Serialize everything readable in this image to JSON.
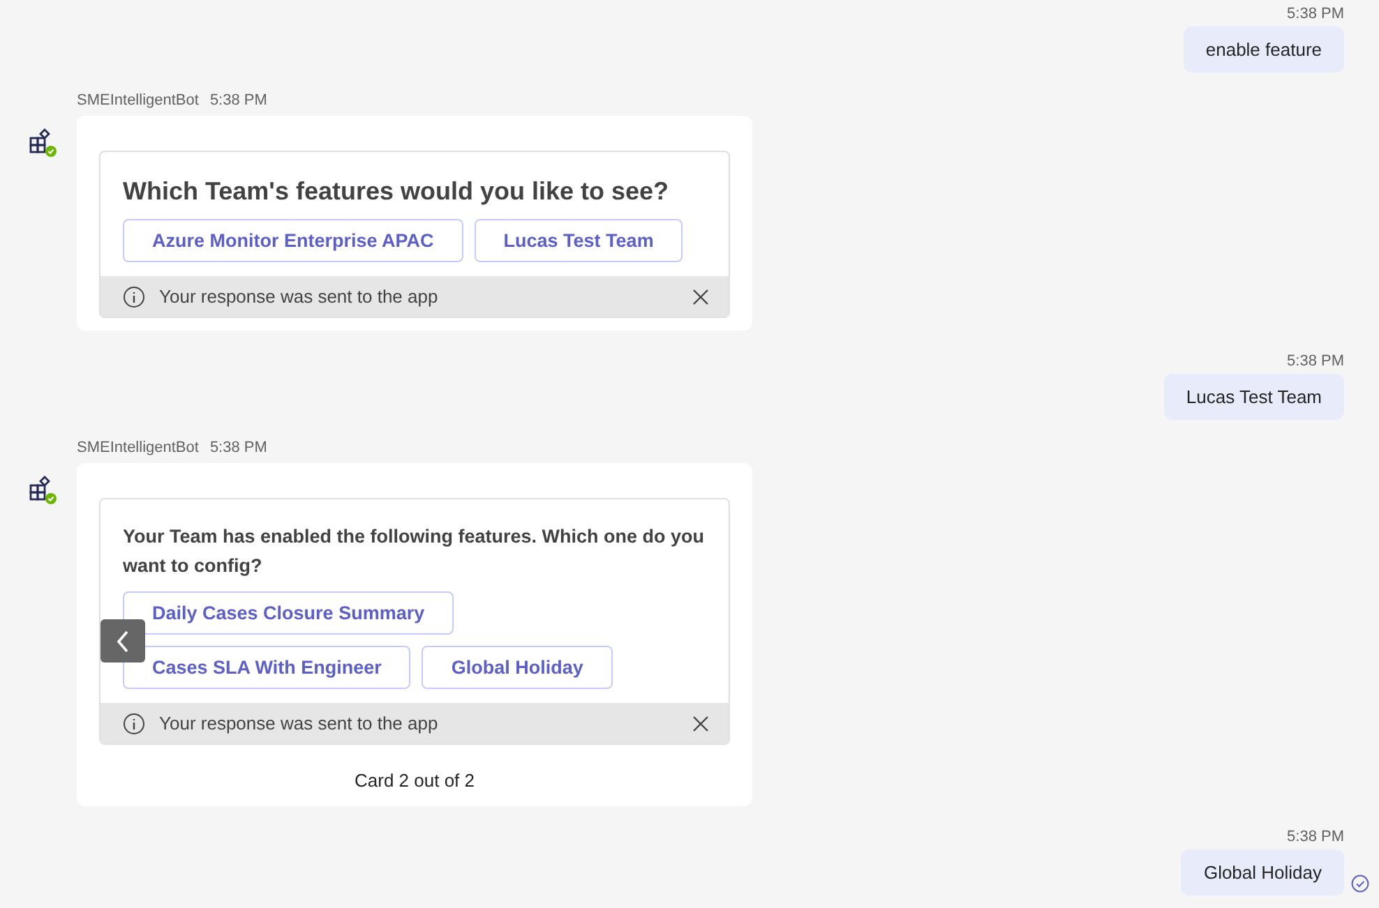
{
  "messages": [
    {
      "kind": "outgoing",
      "time": "5:38 PM",
      "text": "enable feature",
      "delivered": false
    },
    {
      "kind": "bot",
      "sender": "SMEIntelligentBot",
      "time": "5:38 PM",
      "title": "Which Team's features would you like to see?",
      "options": [
        "Azure Monitor Enterprise APAC",
        "Lucas Test Team"
      ],
      "notice": "Your response was sent to the app",
      "has_prev": false
    },
    {
      "kind": "outgoing",
      "time": "5:38 PM",
      "text": "Lucas Test Team",
      "delivered": false
    },
    {
      "kind": "bot",
      "sender": "SMEIntelligentBot",
      "time": "5:38 PM",
      "prompt": "Your Team has enabled the following features. Which one do you want to config?",
      "options": [
        "Daily Cases Closure Summary",
        "Cases SLA With Engineer",
        "Global Holiday"
      ],
      "notice": "Your response was sent to the app",
      "has_prev": true,
      "carousel_label": "Card 2 out of 2"
    },
    {
      "kind": "outgoing",
      "time": "5:38 PM",
      "text": "Global Holiday",
      "delivered": true
    }
  ]
}
